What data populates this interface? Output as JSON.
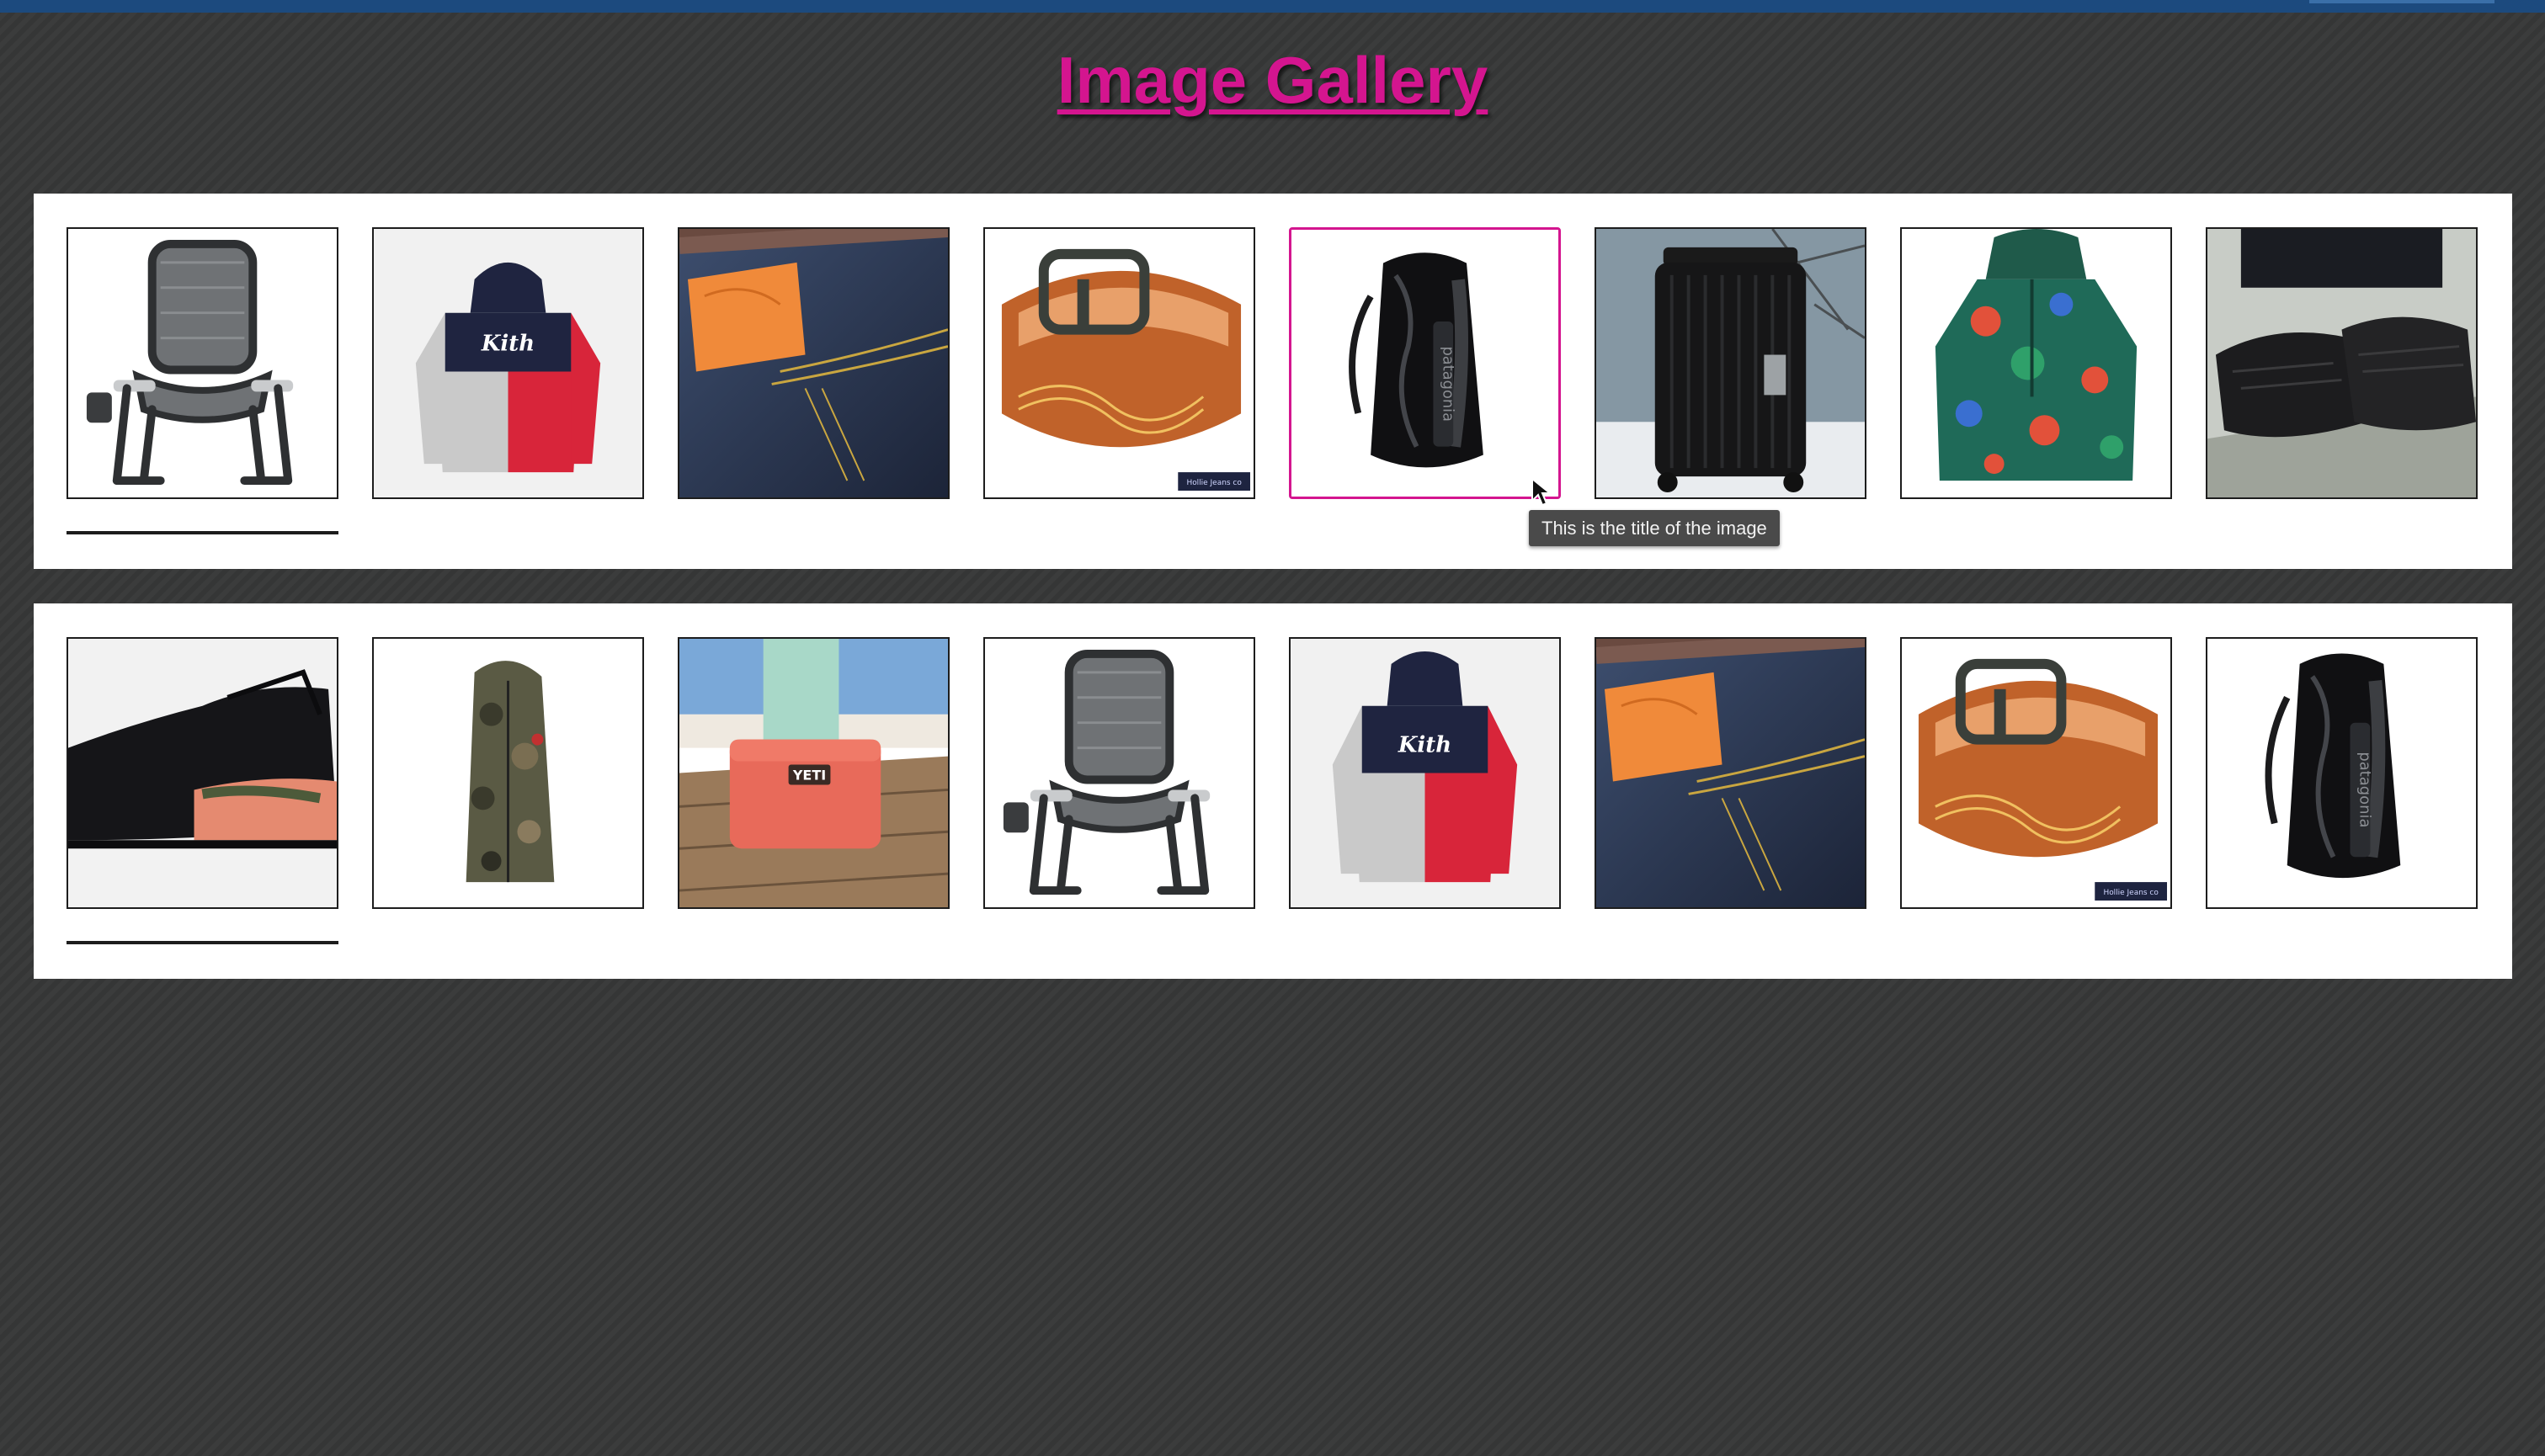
{
  "page": {
    "title": "Image Gallery",
    "colors": {
      "accent": "#d4158f",
      "background": "#373838",
      "topbar": "#1c4a7e"
    }
  },
  "galleries": [
    {
      "items": [
        {
          "name": "folding-chair-image"
        },
        {
          "name": "kith-hoodie-image"
        },
        {
          "name": "denim-jeans-image"
        },
        {
          "name": "leather-belt-image"
        },
        {
          "name": "patagonia-backpack-image",
          "active": true
        },
        {
          "name": "rimowa-suitcase-image"
        },
        {
          "name": "floral-jacket-image"
        },
        {
          "name": "black-sneakers-image"
        }
      ]
    },
    {
      "items": [
        {
          "name": "nike-sneaker-image"
        },
        {
          "name": "camo-parka-image"
        },
        {
          "name": "yeti-cooler-image"
        },
        {
          "name": "folding-chair-image"
        },
        {
          "name": "kith-hoodie-image"
        },
        {
          "name": "denim-jeans-image"
        },
        {
          "name": "leather-belt-image"
        },
        {
          "name": "patagonia-backpack-image"
        }
      ]
    }
  ],
  "tooltip": {
    "text": "This is the title of the image"
  },
  "images": {
    "hoodie_brand": "Kith",
    "belt_stamp": "Hollie Jeans co",
    "cooler_brand": "YETI",
    "backpack_brand": "patagonia"
  }
}
